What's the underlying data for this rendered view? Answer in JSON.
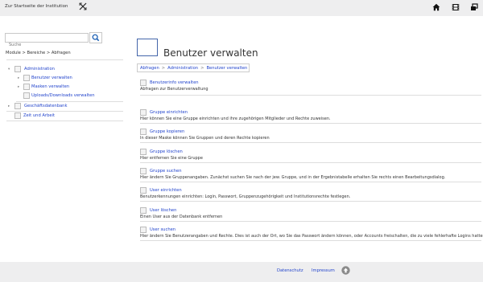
{
  "topbar": {
    "home_link": "Zur Startseite der Institution",
    "icons": [
      "home-icon",
      "film-icon",
      "windows-icon"
    ]
  },
  "search": {
    "placeholder": "Suche"
  },
  "left_breadcrumb": "Module > Bereiche > Abfragen",
  "tree": {
    "items": [
      {
        "label": "Administration",
        "expanded": true
      },
      {
        "label": "Benutzer verwalten",
        "expanded": false
      },
      {
        "label": "Masken verwalten",
        "expanded": false
      },
      {
        "label": "Uploads/Downloads verwalten"
      },
      {
        "label": "Geschäftsdatenbank",
        "expanded": false
      },
      {
        "label": "Zeit und Arbeit"
      }
    ]
  },
  "main": {
    "title": "Benutzer verwalten",
    "crumbs": [
      "Abfragen",
      "Administration",
      "Benutzer verwalten"
    ],
    "crumb_sep": ">",
    "entries": [
      {
        "title": "Benutzerinfo verwalten",
        "desc": "Abfragen zur Benutzerverwaltung"
      },
      {
        "title": "Gruppe einrichten",
        "desc": "Hier können Sie eine Gruppe einrichten und ihre zugehörigen Mitglieder und Rechte zuweisen."
      },
      {
        "title": "Gruppe kopieren",
        "desc": "In dieser Maske können Sie Gruppen und deren Rechte kopieren"
      },
      {
        "title": "Gruppe löschen",
        "desc": "Hier entfernen Sie eine Gruppe"
      },
      {
        "title": "Gruppe suchen",
        "desc": "Hier ändern Sie Gruppenangaben. Zunächst suchen Sie nach der jew. Gruppe, und in der Ergebnistabelle erhalten Sie rechts einen Bearbeitungsdialog."
      },
      {
        "title": "User einrichten",
        "desc": "Benutzerkennungen einrichten: Login, Passwort, Gruppenzugehörigkeit und Institutionsrechte festlegen."
      },
      {
        "title": "User löschen",
        "desc": "Einen User aus der Datenbank entfernen"
      },
      {
        "title": "User suchen",
        "desc": "Hier ändern Sie Benutzerangaben und Rechte. Dies ist auch der Ort, wo Sie das Passwort ändern können, oder Accounts freischalten, die zu viele fehlerhafte Logins hatten."
      }
    ]
  },
  "footer": {
    "privacy": "Datenschutz",
    "imprint": "Impressum"
  },
  "colors": {
    "link": "#2244cc",
    "bar_bg": "#eeeeef",
    "divider": "#dddddd"
  }
}
